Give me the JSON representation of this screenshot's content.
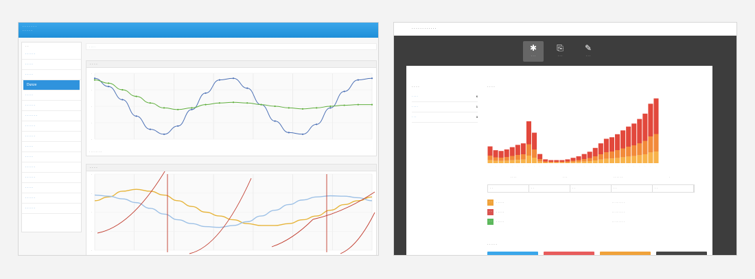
{
  "left_app": {
    "topbar": {
      "line1": "· · · · · · ·",
      "line2": "· · · · ·"
    },
    "sidebar": {
      "head": "· ·",
      "items": [
        {
          "label": "· · · · ·",
          "active": false
        },
        {
          "label": "· · · ·",
          "active": false
        },
        {
          "label": "· · · ·",
          "active": false
        },
        {
          "label": "Dunze",
          "active": true
        },
        {
          "label": "· · · ·",
          "active": false
        },
        {
          "label": "· · · · ·",
          "active": false
        },
        {
          "label": "· · · · · ·",
          "active": false
        },
        {
          "label": "· · · · ·",
          "active": false
        },
        {
          "label": "· · · · ·",
          "active": false
        },
        {
          "label": "· · · ·",
          "active": false
        },
        {
          "label": "· · · ·",
          "active": false
        },
        {
          "label": "· · · · ·",
          "active": false
        },
        {
          "label": "· · · · ·",
          "active": false
        },
        {
          "label": "· · · ·",
          "active": false
        },
        {
          "label": "· · · · ·",
          "active": false
        },
        {
          "label": "· · · · ·",
          "active": false
        }
      ]
    },
    "breadcrumb": "· · · ·",
    "panel1": {
      "title": "· · · ·",
      "status": "· · · · · · · ·"
    },
    "panel2": {
      "title": "· · · ·"
    },
    "colors": {
      "accent": "#2f93dd",
      "series_blue": "#4a6fb5",
      "series_green": "#5fae3c"
    }
  },
  "chart_data": [
    {
      "type": "line",
      "x": [
        0,
        1,
        2,
        3,
        4,
        5,
        6,
        7,
        8,
        9,
        10,
        11,
        12,
        13,
        14,
        15,
        16,
        17,
        18,
        19,
        20
      ],
      "series": [
        {
          "values": [
            0.85,
            0.6,
            0.2,
            -0.3,
            -0.7,
            -0.85,
            -0.6,
            -0.1,
            0.4,
            0.8,
            0.85,
            0.55,
            0.05,
            -0.45,
            -0.8,
            -0.85,
            -0.55,
            -0.05,
            0.45,
            0.8,
            0.85
          ]
        },
        {
          "values": [
            0.8,
            0.7,
            0.5,
            0.3,
            0.1,
            -0.05,
            -0.1,
            -0.05,
            0.05,
            0.1,
            0.12,
            0.1,
            0.05,
            0.0,
            -0.05,
            -0.08,
            -0.05,
            0.0,
            0.03,
            0.05,
            0.05
          ]
        }
      ],
      "ylim": [
        -1,
        1
      ],
      "grid": true
    },
    {
      "type": "line",
      "x": [
        0,
        1,
        2,
        3,
        4,
        5,
        6,
        7,
        8,
        9,
        10,
        11,
        12,
        13,
        14,
        15,
        16,
        17,
        18,
        19,
        20
      ],
      "series": [
        {
          "values": [
            0.3,
            0.4,
            0.55,
            0.6,
            0.55,
            0.45,
            0.3,
            0.15,
            0.0,
            -0.1,
            -0.2,
            -0.3,
            -0.35,
            -0.35,
            -0.3,
            -0.2,
            -0.1,
            0.05,
            0.2,
            0.3,
            0.4
          ]
        },
        {
          "values": [
            0.45,
            0.42,
            0.35,
            0.25,
            0.1,
            -0.05,
            -0.2,
            -0.3,
            -0.38,
            -0.4,
            -0.35,
            -0.25,
            -0.1,
            0.05,
            0.2,
            0.32,
            0.4,
            0.43,
            0.42,
            0.38,
            0.3
          ]
        }
      ],
      "ylim": [
        -1,
        1
      ],
      "grid": true
    },
    {
      "type": "bar",
      "stacked": true,
      "values_total": [
        22,
        17,
        16,
        18,
        21,
        24,
        26,
        55,
        40,
        12,
        5,
        4,
        4,
        4,
        5,
        7,
        9,
        12,
        15,
        20,
        26,
        32,
        34,
        38,
        43,
        48,
        52,
        58,
        65,
        78,
        85
      ],
      "values_lower_fraction": 0.45,
      "ylim": [
        0,
        90
      ]
    }
  ],
  "right_app": {
    "titlebar": "· · · · · · · · · · · ·",
    "nav": [
      {
        "label": "· · ·",
        "icon": "gear-icon",
        "active": true
      },
      {
        "label": "· · ·",
        "icon": "clipboard-icon",
        "active": false
      },
      {
        "label": "· · ·",
        "icon": "pen-icon",
        "active": false
      }
    ],
    "side": {
      "title": "· · · ·",
      "rows": [
        {
          "label": "· · · ·",
          "count": "6"
        },
        {
          "label": "· · · ·",
          "count": "1"
        },
        {
          "label": "· · ·",
          "count": "3"
        }
      ]
    },
    "section_title": "· · · ·",
    "filters": [
      "· · · ·",
      "· · ·",
      "· · · · · ·",
      "·"
    ],
    "table_headers": [
      "· ·",
      "· ·",
      "· ·",
      "· ·",
      "· ·"
    ],
    "legend": [
      {
        "badge": "· ·",
        "label": "· · · · ·",
        "value": "· · · · · · · ·",
        "color": "#f0a23a"
      },
      {
        "badge": "· ·",
        "label": "· · · · ·",
        "value": "· · · · · · · ·",
        "color": "#d9534f"
      },
      {
        "badge": "· ·",
        "label": "· · · · ·",
        "value": "· · · · · · · ·",
        "color": "#5cb85c"
      }
    ],
    "footer_title": "· · · · ·",
    "footer_bars": [
      "#3aa6ea",
      "#e85c5c",
      "#f0a23a",
      "#444444"
    ]
  }
}
